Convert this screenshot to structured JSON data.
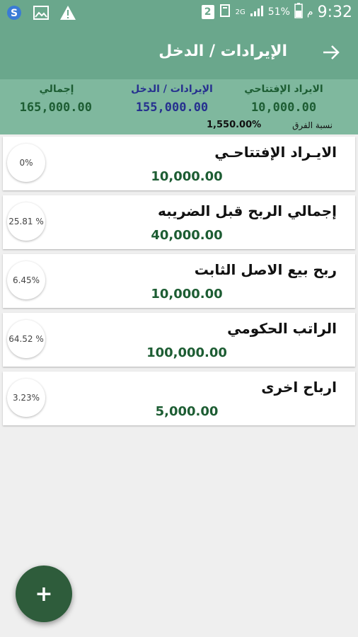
{
  "status_bar": {
    "time": "9:32",
    "am_pm": "م",
    "battery": "51%",
    "network": "2G",
    "sim_badge": "2"
  },
  "app_bar": {
    "title": "الإيرادات / الدخل",
    "back_icon": "arrow-right-icon"
  },
  "summary": {
    "opening_label": "الايراد الإفتتاحي",
    "opening_value": "10,000.00",
    "income_label": "الإيرادات / الدخل",
    "income_value": "155,000.00",
    "total_label": "إجمالي",
    "total_value": "165,000.00",
    "diff_label": "نسبة الفرق",
    "diff_value": "1,550.00%"
  },
  "items": [
    {
      "title": "الايـراد الإفتتاحـي",
      "amount": "10,000.00",
      "percent": "0%"
    },
    {
      "title": "إجمالي الربح قبل الضريبه",
      "amount": "40,000.00",
      "percent": "25.81 %"
    },
    {
      "title": "ربح بيع الاصل الثابت",
      "amount": "10,000.00",
      "percent": "6.45%"
    },
    {
      "title": "الراتب الحكومي",
      "amount": "100,000.00",
      "percent": "64.52 %"
    },
    {
      "title": "ارباح اخرى",
      "amount": "5,000.00",
      "percent": "3.23%"
    }
  ],
  "fab": {
    "label": "+"
  },
  "colors": {
    "primary": "#6aa78c",
    "summary_bg": "#7fb89e",
    "amount": "#1d5d33",
    "income_text": "#26308f",
    "fab": "#2e5c3b"
  }
}
